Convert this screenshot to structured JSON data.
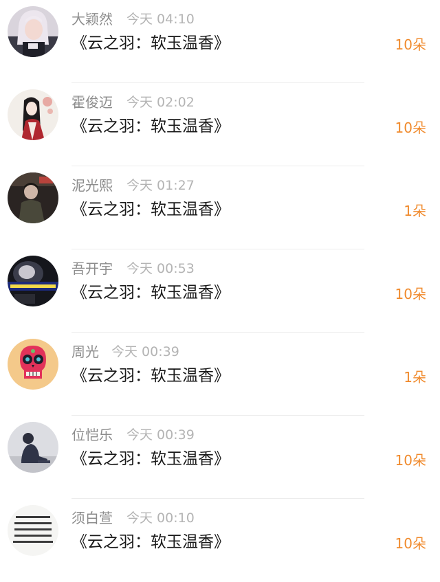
{
  "accent_color": "#f08a2c",
  "records": [
    {
      "name": "大颖然",
      "time": "今天 04:10",
      "gift": "《云之羽：软玉温香》",
      "count": "10朵",
      "avatar_icon": "girl-photo-icon"
    },
    {
      "name": "霍俊迈",
      "time": "今天 02:02",
      "gift": "《云之羽：软玉温香》",
      "count": "10朵",
      "avatar_icon": "anime-girl-icon"
    },
    {
      "name": "泥光熙",
      "time": "今天 01:27",
      "gift": "《云之羽：软玉温香》",
      "count": "1朵",
      "avatar_icon": "person-photo-icon"
    },
    {
      "name": "吾开宇",
      "time": "今天 00:53",
      "gift": "《云之羽：软玉温香》",
      "count": "10朵",
      "avatar_icon": "dark-photo-icon"
    },
    {
      "name": "周光",
      "time": "今天 00:39",
      "gift": "《云之羽：软玉温香》",
      "count": "1朵",
      "avatar_icon": "skull-icon"
    },
    {
      "name": "位恺乐",
      "time": "今天 00:39",
      "gift": "《云之羽：软玉温香》",
      "count": "10朵",
      "avatar_icon": "sitting-person-icon"
    },
    {
      "name": "须白萱",
      "time": "今天 00:10",
      "gift": "《云之羽：软玉温香》",
      "count": "10朵",
      "avatar_icon": "text-image-icon"
    }
  ]
}
